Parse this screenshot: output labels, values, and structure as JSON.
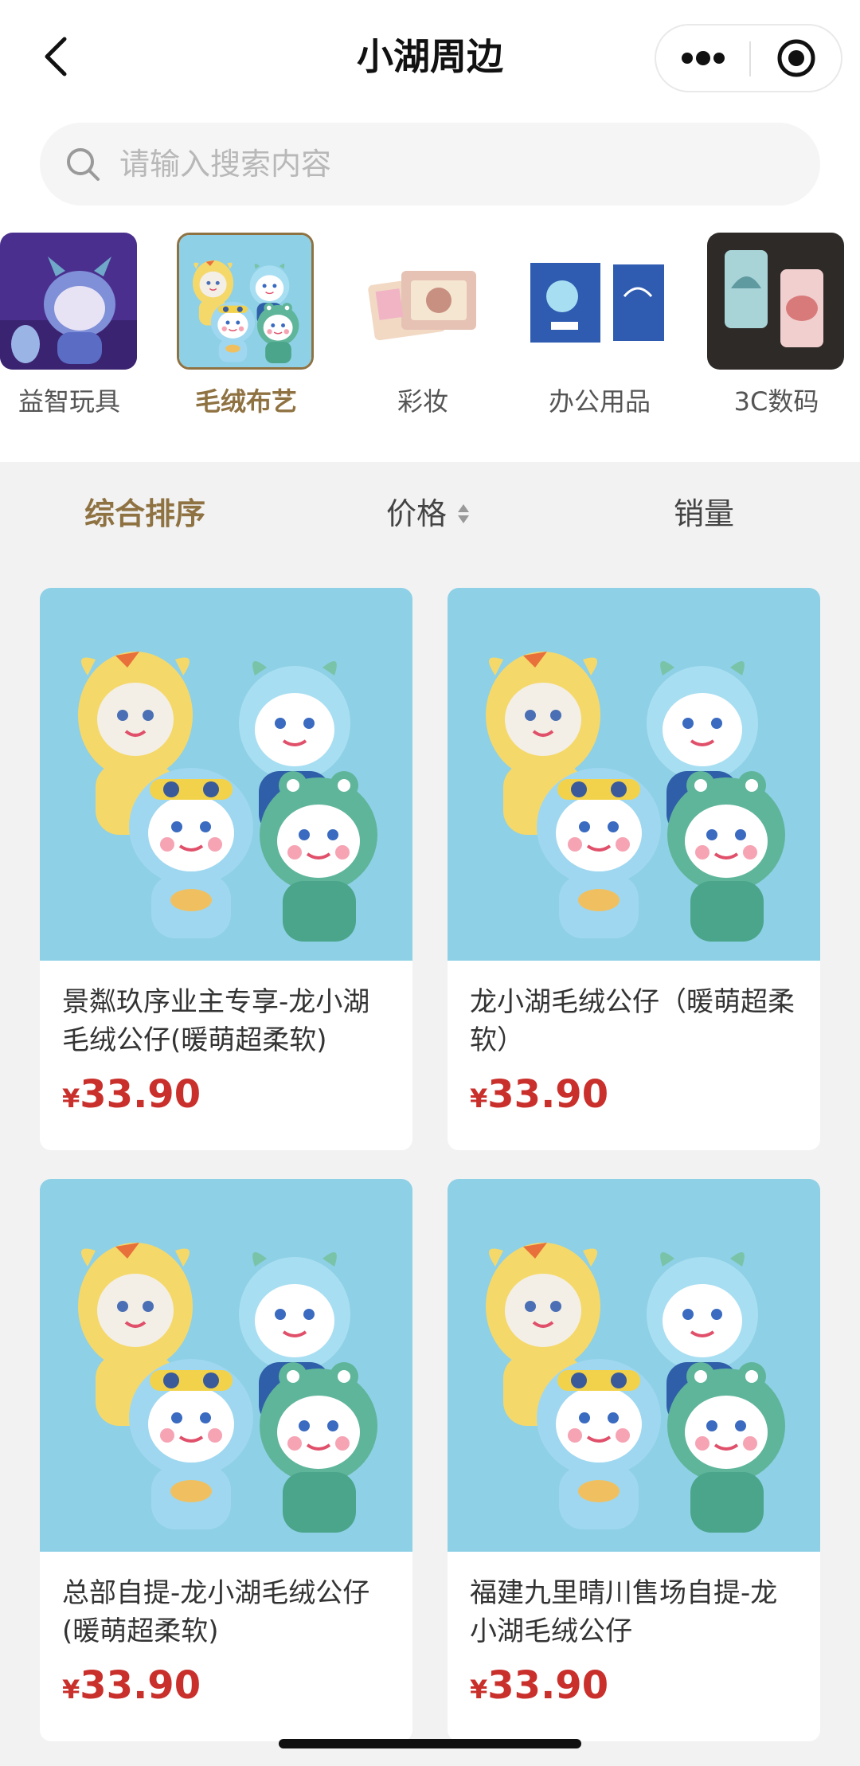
{
  "navbar": {
    "title": "小湖周边"
  },
  "search": {
    "placeholder": "请输入搜索内容"
  },
  "categories": [
    {
      "label": "益智玩具",
      "selected": false
    },
    {
      "label": "毛绒布艺",
      "selected": true
    },
    {
      "label": "彩妆",
      "selected": false
    },
    {
      "label": "办公用品",
      "selected": false
    },
    {
      "label": "3C数码",
      "selected": false
    }
  ],
  "sort": {
    "composite": "综合排序",
    "price": "价格",
    "sales": "销量"
  },
  "products": [
    {
      "title": "景粼玖序业主专享-龙小湖毛绒公仔(暖萌超柔软)",
      "currency": "¥",
      "price": "33.90"
    },
    {
      "title": "龙小湖毛绒公仔（暖萌超柔软）",
      "currency": "¥",
      "price": "33.90"
    },
    {
      "title": "总部自提-龙小湖毛绒公仔(暖萌超柔软)",
      "currency": "¥",
      "price": "33.90"
    },
    {
      "title": "福建九里晴川售场自提-龙小湖毛绒公仔",
      "currency": "¥",
      "price": "33.90"
    }
  ],
  "colors": {
    "accent": "#8f7242",
    "price": "#c9302c",
    "product_bg": "#8ed0e6"
  }
}
